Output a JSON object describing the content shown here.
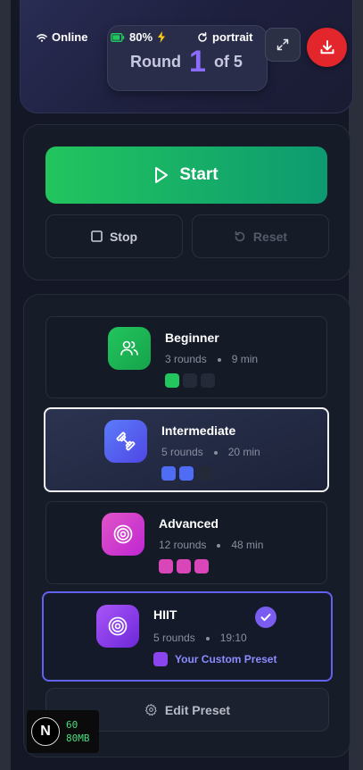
{
  "status": {
    "network": "Online",
    "battery": "80%",
    "orientation": "portrait"
  },
  "round": {
    "prefix": "Round",
    "current": "1",
    "suffix": "of 5"
  },
  "controls": {
    "start": "Start",
    "stop": "Stop",
    "reset": "Reset"
  },
  "presets": [
    {
      "name": "Beginner",
      "rounds": "3 rounds",
      "duration": "9 min",
      "color": "#22c55e",
      "intensity_level": 1,
      "intensity_max": 3,
      "icon": "users-icon"
    },
    {
      "name": "Intermediate",
      "rounds": "5 rounds",
      "duration": "20 min",
      "color": "#4f6cf5",
      "intensity_level": 2,
      "intensity_max": 3,
      "icon": "dumbbell-icon",
      "selected": true
    },
    {
      "name": "Advanced",
      "rounds": "12 rounds",
      "duration": "48 min",
      "color": "#d946b8",
      "intensity_level": 3,
      "intensity_max": 3,
      "icon": "target-icon"
    },
    {
      "name": "HIIT",
      "rounds": "5 rounds",
      "duration": "19:10",
      "color": "#8b45ef",
      "icon": "target-icon",
      "custom_label": "Your Custom Preset",
      "active": true
    }
  ],
  "edit_preset": "Edit Preset",
  "dev_stats": {
    "logo": "N",
    "fps": "60",
    "memory": "80MB"
  }
}
